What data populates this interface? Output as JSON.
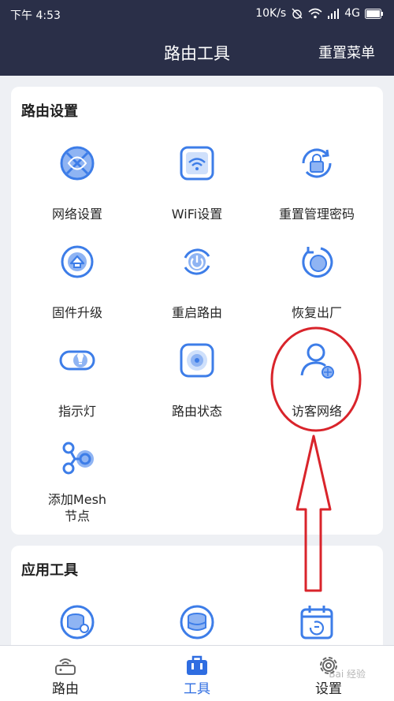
{
  "status_bar": {
    "time": "下午 4:53",
    "network_speed": "10K/s",
    "network_type": "4G"
  },
  "header": {
    "title": "路由工具",
    "action_label": "重置菜单"
  },
  "router_settings": {
    "title": "路由设置",
    "items": [
      {
        "label": "网络设置",
        "icon": "network-settings-icon"
      },
      {
        "label": "WiFi设置",
        "icon": "wifi-settings-icon"
      },
      {
        "label": "重置管理密码",
        "icon": "reset-password-icon"
      },
      {
        "label": "固件升级",
        "icon": "firmware-upgrade-icon"
      },
      {
        "label": "重启路由",
        "icon": "reboot-icon"
      },
      {
        "label": "恢复出厂",
        "icon": "factory-reset-icon"
      },
      {
        "label": "指示灯",
        "icon": "indicator-light-icon"
      },
      {
        "label": "路由状态",
        "icon": "router-status-icon"
      },
      {
        "label": "访客网络",
        "icon": "guest-network-icon"
      },
      {
        "label_line1": "添加Mesh",
        "label_line2": "节点",
        "icon": "add-mesh-node-icon"
      }
    ]
  },
  "app_tools": {
    "title": "应用工具",
    "items": [
      {
        "icon": "storage-download-icon"
      },
      {
        "icon": "storage-icon"
      },
      {
        "icon": "schedule-calendar-icon"
      }
    ]
  },
  "bottom_nav": {
    "tabs": [
      {
        "label": "路由",
        "icon": "router-tab-icon",
        "active": false
      },
      {
        "label": "工具",
        "icon": "toolbox-tab-icon",
        "active": true
      },
      {
        "label": "设置",
        "icon": "gear-tab-icon",
        "active": false
      }
    ]
  },
  "watermark": "Bai 经验",
  "colors": {
    "header_bg": "#2a2f48",
    "accent": "#2f6de1",
    "icon_blue": "#3d7de8",
    "annotation_red": "#d9242b",
    "page_bg": "#eef0f4"
  }
}
